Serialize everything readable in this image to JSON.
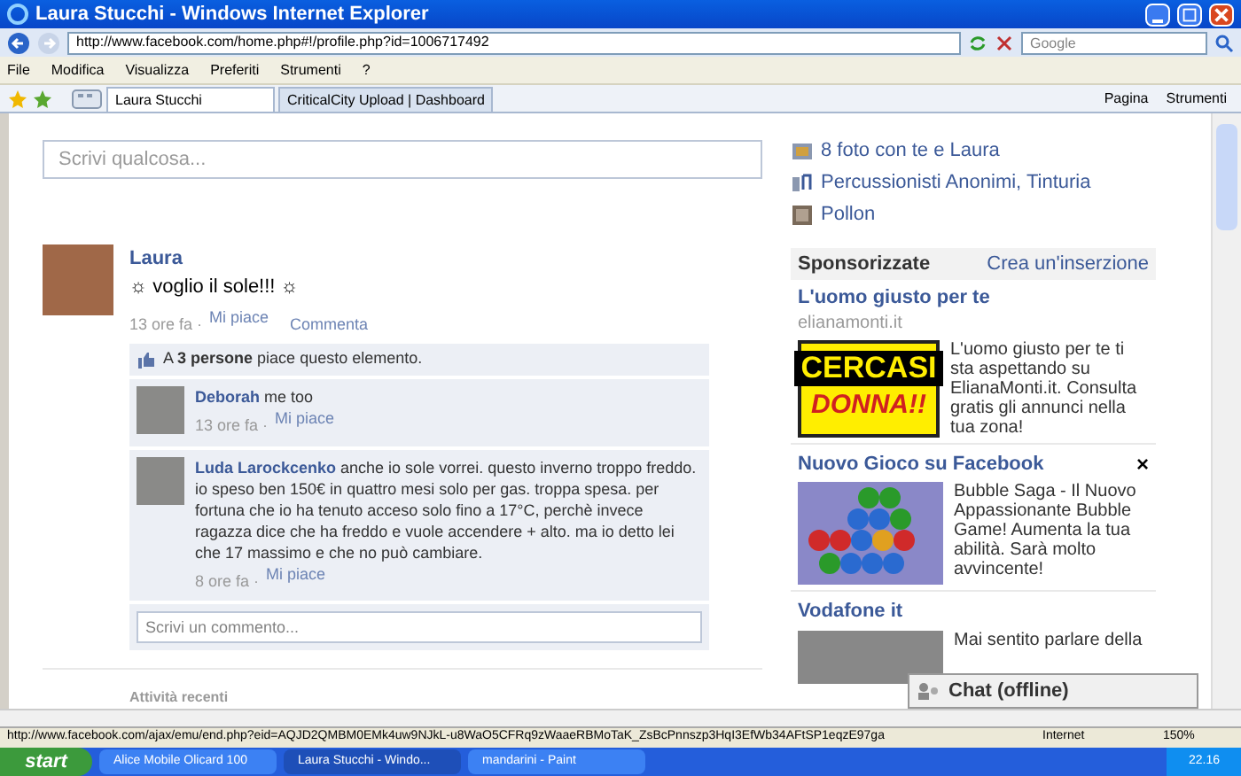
{
  "window": {
    "title": "Laura Stucchi - Windows Internet Explorer"
  },
  "address_bar": {
    "url": "http://www.facebook.com/home.php#!/profile.php?id=1006717492",
    "search_placeholder": "Google"
  },
  "menu": [
    "File",
    "Modifica",
    "Visualizza",
    "Preferiti",
    "Strumenti",
    "?"
  ],
  "tabs": [
    {
      "label": "Laura Stucchi",
      "selected": true
    },
    {
      "label": "CriticalCity Upload | Dashboard",
      "selected": false
    }
  ],
  "toolbar": [
    "Pagina",
    "Strumenti"
  ],
  "composer": {
    "placeholder": "Scrivi qualcosa..."
  },
  "post": {
    "author": "Laura",
    "text": "☼ voglio il sole!!! ☼",
    "time": "13 ore fa ·",
    "like": "Mi piace",
    "comment": "Commenta",
    "likes": "A **3 persone** piace questo elemento.",
    "comments": [
      {
        "author": "Deborah",
        "text": "me too",
        "time": "13 ore fa ·",
        "like": "Mi piace"
      },
      {
        "author": "Luda Larockcenko",
        "text": "anche io sole vorrei. questo inverno troppo freddo. io speso ben 150€ in quattro mesi solo per gas. troppa spesa. per fortuna che io ha tenuto acceso solo fino a 17°C, perchè invece ragazza dice che ha freddo e vuole accendere + alto. ma io detto lei che 17 massimo e che no può cambiare.",
        "time": "8 ore fa ·",
        "like": "Mi piace"
      }
    ],
    "comment_placeholder": "Scrivi un commento..."
  },
  "recent_activity": "Attività recenti",
  "sidebar": {
    "links": [
      {
        "kind": "photo",
        "label": "8 foto con te e Laura"
      },
      {
        "kind": "music",
        "label": "Percussionisti Anonimi, Tinturia"
      },
      {
        "kind": "film",
        "label": "Pollon"
      }
    ],
    "sponsored": {
      "title": "Sponsorizzate",
      "create": "Crea un'inserzione"
    },
    "ads": [
      {
        "title": "L'uomo giusto per te",
        "domain": "elianamonti.it",
        "image_text": [
          "CERCASI",
          "DONNA!!"
        ],
        "text": "L'uomo giusto per te ti sta aspettando su ElianaMonti.it. Consulta gratis gli annunci nella tua zona!"
      },
      {
        "title": "Nuovo Gioco su Facebook",
        "text": "Bubble Saga - Il Nuovo Appassionante Bubble Game! Aumenta la tua abilità. Sarà molto avvincente!",
        "close_label": "×"
      },
      {
        "title": "Vodafone it",
        "text": "Mai sentito parlare della"
      }
    ]
  },
  "chat": {
    "label": "Chat (offline)"
  },
  "status_bar": {
    "url": "http://www.facebook.com/ajax/emu/end.php?eid=AQJD2QMBM0EMk4uw9NJkL-u8WaO5CFRq9zWaaeRBMoTaK_ZsBcPnnszp3HqI3EfWb34AFtSP1eqzE97ga",
    "zone": "Internet",
    "zoom": "150%"
  },
  "taskbar": {
    "start": "start",
    "items": [
      {
        "label": "Alice Mobile Olicard 100",
        "selected": false
      },
      {
        "label": "Laura Stucchi - Windo...",
        "selected": true
      },
      {
        "label": "mandarini - Paint",
        "selected": false
      }
    ],
    "clock": "22.16"
  }
}
